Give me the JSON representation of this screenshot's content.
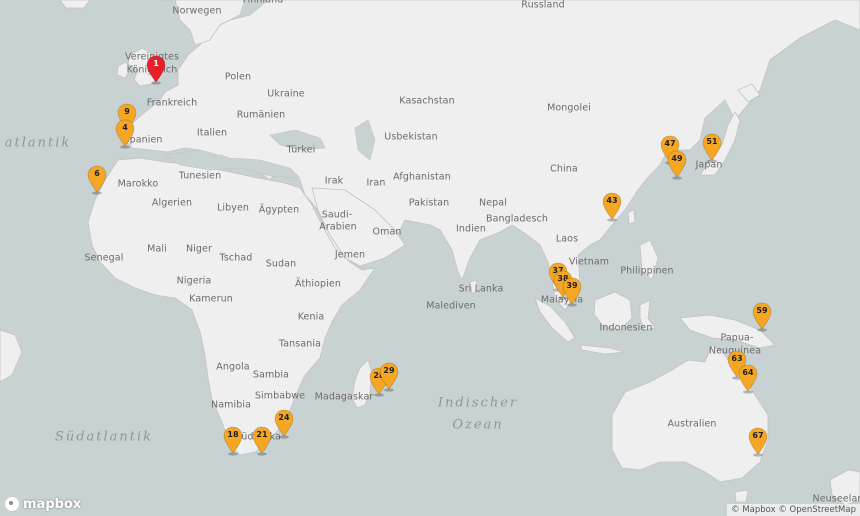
{
  "map": {
    "country_labels": [
      {
        "id": "norwegen",
        "text": "Norwegen"
      },
      {
        "id": "finnland",
        "text": "Finnland"
      },
      {
        "id": "russland",
        "text": "Russland"
      },
      {
        "id": "vereinigtes",
        "text": "Vereinigtes"
      },
      {
        "id": "konigreich",
        "text": "Königreich"
      },
      {
        "id": "polen",
        "text": "Polen"
      },
      {
        "id": "ukraine",
        "text": "Ukraine"
      },
      {
        "id": "frankreich",
        "text": "Frankreich"
      },
      {
        "id": "rumanien",
        "text": "Rumänien"
      },
      {
        "id": "kasachstan",
        "text": "Kasachstan"
      },
      {
        "id": "mongolei",
        "text": "Mongolei"
      },
      {
        "id": "spanien",
        "text": "Spanien"
      },
      {
        "id": "italien",
        "text": "Italien"
      },
      {
        "id": "usbekistan",
        "text": "Usbekistan"
      },
      {
        "id": "turkei",
        "text": "Türkei"
      },
      {
        "id": "china",
        "text": "China"
      },
      {
        "id": "japan",
        "text": "Japan"
      },
      {
        "id": "marokko",
        "text": "Marokko"
      },
      {
        "id": "tunesien",
        "text": "Tunesien"
      },
      {
        "id": "irak",
        "text": "Irak"
      },
      {
        "id": "iran",
        "text": "Iran"
      },
      {
        "id": "afghanistan",
        "text": "Afghanistan"
      },
      {
        "id": "algerien",
        "text": "Algerien"
      },
      {
        "id": "libyen",
        "text": "Libyen"
      },
      {
        "id": "agypten",
        "text": "Ägypten"
      },
      {
        "id": "saudi",
        "text": "Saudi-"
      },
      {
        "id": "arabien",
        "text": "Arabien"
      },
      {
        "id": "pakistan",
        "text": "Pakistan"
      },
      {
        "id": "nepal",
        "text": "Nepal"
      },
      {
        "id": "bangladesch",
        "text": "Bangladesch"
      },
      {
        "id": "indien",
        "text": "Indien"
      },
      {
        "id": "oman",
        "text": "Oman"
      },
      {
        "id": "laos",
        "text": "Laos"
      },
      {
        "id": "mali",
        "text": "Mali"
      },
      {
        "id": "niger",
        "text": "Niger"
      },
      {
        "id": "senegal",
        "text": "Senegal"
      },
      {
        "id": "tschad",
        "text": "Tschad"
      },
      {
        "id": "sudan",
        "text": "Sudan"
      },
      {
        "id": "jemen",
        "text": "Jemen"
      },
      {
        "id": "vietnam",
        "text": "Vietnam"
      },
      {
        "id": "philippinen",
        "text": "Philippinen"
      },
      {
        "id": "nigeria",
        "text": "Nigeria"
      },
      {
        "id": "athiopien",
        "text": "Äthiopien"
      },
      {
        "id": "srilanka",
        "text": "Sri Lanka"
      },
      {
        "id": "kamerun",
        "text": "Kamerun"
      },
      {
        "id": "malaysia",
        "text": "Malaysia"
      },
      {
        "id": "malediven",
        "text": "Malediven"
      },
      {
        "id": "kenia",
        "text": "Kenia"
      },
      {
        "id": "indonesien",
        "text": "Indonesien"
      },
      {
        "id": "papua",
        "text": "Papua-"
      },
      {
        "id": "neuguinea",
        "text": "Neuguinea"
      },
      {
        "id": "tansania",
        "text": "Tansania"
      },
      {
        "id": "angola",
        "text": "Angola"
      },
      {
        "id": "sambia",
        "text": "Sambia"
      },
      {
        "id": "simbabwe",
        "text": "Simbabwe"
      },
      {
        "id": "madagaskar",
        "text": "Madagaskar"
      },
      {
        "id": "namibia",
        "text": "Namibia"
      },
      {
        "id": "australien",
        "text": "Australien"
      },
      {
        "id": "sudafrika",
        "text": "Südafrika"
      },
      {
        "id": "neuseeland",
        "text": "Neuseelan"
      }
    ],
    "ocean_labels": [
      {
        "id": "atlantik",
        "text": "atlantik"
      },
      {
        "id": "sudatlantik",
        "text": "Südatlantik"
      },
      {
        "id": "indischer",
        "text": "Indischer"
      },
      {
        "id": "ozean",
        "text": "Ozean"
      }
    ],
    "markers": [
      {
        "label": "1",
        "color": "#e8202a",
        "selected": true
      },
      {
        "label": "9",
        "color": "#f5a623"
      },
      {
        "label": "4",
        "color": "#f5a623"
      },
      {
        "label": "6",
        "color": "#f5a623"
      },
      {
        "label": "18",
        "color": "#f5a623"
      },
      {
        "label": "21",
        "color": "#f5a623"
      },
      {
        "label": "24",
        "color": "#f5a623"
      },
      {
        "label": "28",
        "color": "#f5a623"
      },
      {
        "label": "29",
        "color": "#f5a623"
      },
      {
        "label": "37",
        "color": "#f5a623"
      },
      {
        "label": "38",
        "color": "#f5a623"
      },
      {
        "label": "39",
        "color": "#f5a623"
      },
      {
        "label": "43",
        "color": "#f5a623"
      },
      {
        "label": "47",
        "color": "#f5a623"
      },
      {
        "label": "49",
        "color": "#f5a623"
      },
      {
        "label": "51",
        "color": "#f5a623"
      },
      {
        "label": "59",
        "color": "#f5a623"
      },
      {
        "label": "63",
        "color": "#f5a623"
      },
      {
        "label": "64",
        "color": "#f5a623"
      },
      {
        "label": "67",
        "color": "#f5a623"
      }
    ],
    "colors": {
      "water": "#c9d2d3",
      "land": "#efefef",
      "border": "#c2c2c2",
      "marker": "#f5a623",
      "selected_marker": "#e8202a"
    }
  },
  "attribution": {
    "mapbox": "© Mapbox",
    "osm": "© OpenStreetMap"
  },
  "logo": {
    "text": "mapbox"
  }
}
